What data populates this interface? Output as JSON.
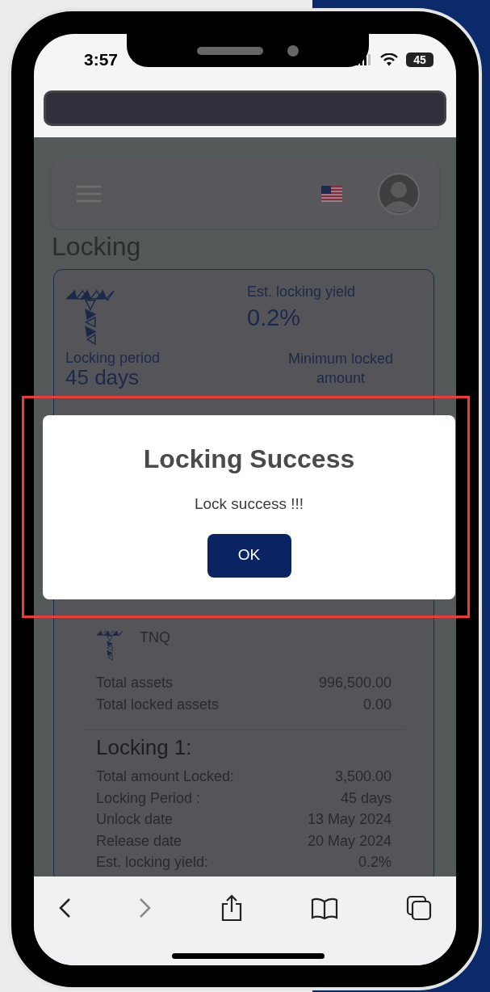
{
  "status_bar": {
    "time": "3:57",
    "battery": "45"
  },
  "page": {
    "title": "Locking",
    "product": {
      "yield_label": "Est. locking yield",
      "yield_value": "0.2%",
      "period_label": "Locking period",
      "period_value": "45 days",
      "minimum_label": "Minimum locked amount"
    },
    "holdings": {
      "token": "TNQ",
      "rows": [
        {
          "label": "Total assets",
          "value": "996,500.00"
        },
        {
          "label": "Total locked assets",
          "value": "0.00"
        }
      ]
    },
    "locking": {
      "title": "Locking 1:",
      "rows": [
        {
          "label": "Total amount Locked:",
          "value": "3,500.00"
        },
        {
          "label": "Locking Period :",
          "value": "45 days"
        },
        {
          "label": "Unlock date",
          "value": "13 May 2024"
        },
        {
          "label": "Release date",
          "value": "20 May 2024"
        },
        {
          "label": "Est. locking yield:",
          "value": "0.2%"
        }
      ]
    }
  },
  "dialog": {
    "title": "Locking Success",
    "message": "Lock success !!!",
    "button": "OK"
  }
}
